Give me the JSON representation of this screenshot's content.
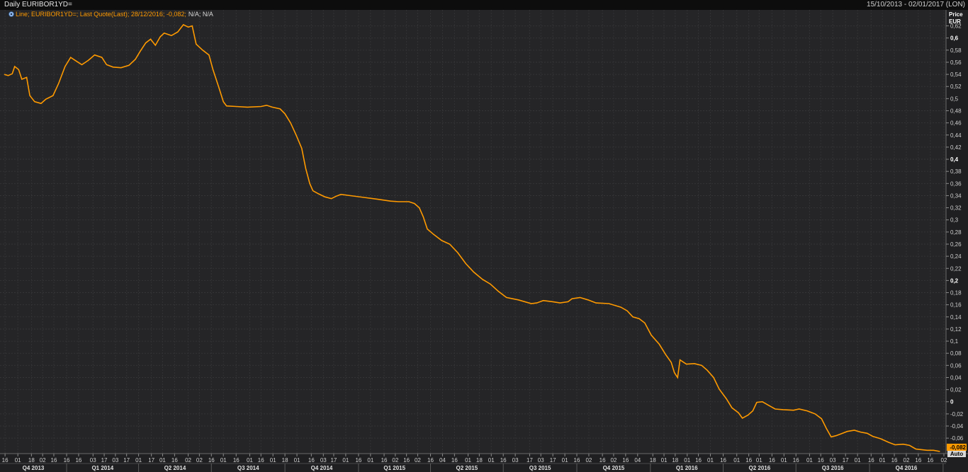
{
  "window": {
    "title": "Daily EURIBOR1YD=",
    "date_range": "15/10/2013 - 02/01/2017 (LON)"
  },
  "legend": {
    "text": "Line; EURIBOR1YD=; Last Quote(Last); 28/12/2016; -0,082;",
    "na_text": "N/A; N/A",
    "icon": "gear-icon"
  },
  "axis": {
    "unit_label_1": "Price",
    "unit_label_2": "EUR",
    "auto_label": "Auto",
    "last_value_label": "-0,082"
  },
  "colors": {
    "series": "#ff9a00",
    "background": "#252527",
    "grid": "#3a3a3c",
    "last_value_bg": "#ff9a00"
  },
  "chart_data": {
    "type": "line",
    "series": [
      {
        "name": "EURIBOR1YD=",
        "points": [
          [
            "2013-10-15",
            0.54
          ],
          [
            "2013-10-20",
            0.538
          ],
          [
            "2013-10-25",
            0.541
          ],
          [
            "2013-10-28",
            0.553
          ],
          [
            "2013-11-02",
            0.548
          ],
          [
            "2013-11-06",
            0.532
          ],
          [
            "2013-11-12",
            0.535
          ],
          [
            "2013-11-16",
            0.505
          ],
          [
            "2013-11-22",
            0.495
          ],
          [
            "2013-11-30",
            0.492
          ],
          [
            "2013-12-06",
            0.499
          ],
          [
            "2013-12-15",
            0.505
          ],
          [
            "2013-12-22",
            0.525
          ],
          [
            "2013-12-30",
            0.553
          ],
          [
            "2014-01-06",
            0.568
          ],
          [
            "2014-01-14",
            0.561
          ],
          [
            "2014-01-20",
            0.556
          ],
          [
            "2014-01-28",
            0.563
          ],
          [
            "2014-02-05",
            0.572
          ],
          [
            "2014-02-14",
            0.568
          ],
          [
            "2014-02-20",
            0.556
          ],
          [
            "2014-02-28",
            0.552
          ],
          [
            "2014-03-10",
            0.551
          ],
          [
            "2014-03-20",
            0.555
          ],
          [
            "2014-03-28",
            0.565
          ],
          [
            "2014-04-03",
            0.578
          ],
          [
            "2014-04-10",
            0.592
          ],
          [
            "2014-04-16",
            0.598
          ],
          [
            "2014-04-22",
            0.588
          ],
          [
            "2014-04-28",
            0.602
          ],
          [
            "2014-05-03",
            0.608
          ],
          [
            "2014-05-12",
            0.604
          ],
          [
            "2014-05-20",
            0.61
          ],
          [
            "2014-05-27",
            0.622
          ],
          [
            "2014-06-02",
            0.618
          ],
          [
            "2014-06-07",
            0.62
          ],
          [
            "2014-06-12",
            0.59
          ],
          [
            "2014-06-20",
            0.58
          ],
          [
            "2014-06-28",
            0.572
          ],
          [
            "2014-07-03",
            0.548
          ],
          [
            "2014-07-10",
            0.52
          ],
          [
            "2014-07-16",
            0.495
          ],
          [
            "2014-07-20",
            0.488
          ],
          [
            "2014-08-01",
            0.487
          ],
          [
            "2014-08-15",
            0.486
          ],
          [
            "2014-09-01",
            0.487
          ],
          [
            "2014-09-08",
            0.489
          ],
          [
            "2014-09-15",
            0.486
          ],
          [
            "2014-09-25",
            0.483
          ],
          [
            "2014-10-01",
            0.475
          ],
          [
            "2014-10-08",
            0.46
          ],
          [
            "2014-10-15",
            0.44
          ],
          [
            "2014-10-22",
            0.418
          ],
          [
            "2014-10-27",
            0.385
          ],
          [
            "2014-11-01",
            0.36
          ],
          [
            "2014-11-05",
            0.348
          ],
          [
            "2014-11-12",
            0.343
          ],
          [
            "2014-11-20",
            0.338
          ],
          [
            "2014-11-28",
            0.335
          ],
          [
            "2014-12-04",
            0.339
          ],
          [
            "2014-12-10",
            0.342
          ],
          [
            "2014-12-22",
            0.34
          ],
          [
            "2015-01-08",
            0.337
          ],
          [
            "2015-01-25",
            0.334
          ],
          [
            "2015-02-10",
            0.331
          ],
          [
            "2015-02-20",
            0.33
          ],
          [
            "2015-03-05",
            0.33
          ],
          [
            "2015-03-12",
            0.327
          ],
          [
            "2015-03-18",
            0.32
          ],
          [
            "2015-03-23",
            0.305
          ],
          [
            "2015-03-28",
            0.285
          ],
          [
            "2015-04-05",
            0.276
          ],
          [
            "2015-04-15",
            0.266
          ],
          [
            "2015-04-25",
            0.26
          ],
          [
            "2015-05-05",
            0.246
          ],
          [
            "2015-05-15",
            0.228
          ],
          [
            "2015-05-25",
            0.214
          ],
          [
            "2015-06-05",
            0.202
          ],
          [
            "2015-06-15",
            0.194
          ],
          [
            "2015-06-25",
            0.182
          ],
          [
            "2015-07-05",
            0.172
          ],
          [
            "2015-07-20",
            0.168
          ],
          [
            "2015-08-05",
            0.162
          ],
          [
            "2015-08-12",
            0.163
          ],
          [
            "2015-08-20",
            0.167
          ],
          [
            "2015-09-01",
            0.165
          ],
          [
            "2015-09-10",
            0.163
          ],
          [
            "2015-09-20",
            0.165
          ],
          [
            "2015-09-25",
            0.17
          ],
          [
            "2015-10-05",
            0.172
          ],
          [
            "2015-10-15",
            0.168
          ],
          [
            "2015-10-25",
            0.163
          ],
          [
            "2015-11-10",
            0.162
          ],
          [
            "2015-11-25",
            0.156
          ],
          [
            "2015-12-03",
            0.15
          ],
          [
            "2015-12-10",
            0.14
          ],
          [
            "2015-12-18",
            0.137
          ],
          [
            "2015-12-25",
            0.13
          ],
          [
            "2016-01-02",
            0.11
          ],
          [
            "2016-01-12",
            0.095
          ],
          [
            "2016-01-20",
            0.078
          ],
          [
            "2016-01-27",
            0.065
          ],
          [
            "2016-01-31",
            0.048
          ],
          [
            "2016-02-04",
            0.04
          ],
          [
            "2016-02-07",
            0.069
          ],
          [
            "2016-02-15",
            0.062
          ],
          [
            "2016-02-25",
            0.063
          ],
          [
            "2016-03-05",
            0.06
          ],
          [
            "2016-03-12",
            0.052
          ],
          [
            "2016-03-20",
            0.04
          ],
          [
            "2016-03-27",
            0.021
          ],
          [
            "2016-04-05",
            0.005
          ],
          [
            "2016-04-12",
            -0.01
          ],
          [
            "2016-04-20",
            -0.018
          ],
          [
            "2016-04-25",
            -0.027
          ],
          [
            "2016-05-02",
            -0.022
          ],
          [
            "2016-05-08",
            -0.015
          ],
          [
            "2016-05-13",
            -0.001
          ],
          [
            "2016-05-20",
            0.0
          ],
          [
            "2016-05-28",
            -0.006
          ],
          [
            "2016-06-05",
            -0.012
          ],
          [
            "2016-06-15",
            -0.013
          ],
          [
            "2016-06-28",
            -0.014
          ],
          [
            "2016-07-05",
            -0.012
          ],
          [
            "2016-07-15",
            -0.015
          ],
          [
            "2016-07-25",
            -0.02
          ],
          [
            "2016-08-02",
            -0.028
          ],
          [
            "2016-08-08",
            -0.044
          ],
          [
            "2016-08-14",
            -0.058
          ],
          [
            "2016-08-20",
            -0.056
          ],
          [
            "2016-08-26",
            -0.053
          ],
          [
            "2016-09-03",
            -0.049
          ],
          [
            "2016-09-12",
            -0.047
          ],
          [
            "2016-09-20",
            -0.05
          ],
          [
            "2016-09-28",
            -0.052
          ],
          [
            "2016-10-05",
            -0.057
          ],
          [
            "2016-10-15",
            -0.061
          ],
          [
            "2016-10-25",
            -0.067
          ],
          [
            "2016-11-02",
            -0.071
          ],
          [
            "2016-11-12",
            -0.07
          ],
          [
            "2016-11-20",
            -0.072
          ],
          [
            "2016-11-28",
            -0.078
          ],
          [
            "2016-12-05",
            -0.079
          ],
          [
            "2016-12-12",
            -0.08
          ],
          [
            "2016-12-20",
            -0.08
          ],
          [
            "2016-12-28",
            -0.082
          ]
        ]
      }
    ],
    "x_range": [
      "2013-10-15",
      "2017-01-02"
    ],
    "ylim": [
      -0.082,
      0.63
    ],
    "y_ticks": [
      "0,62",
      "0,6",
      "0,58",
      "0,56",
      "0,54",
      "0,52",
      "0,5",
      "0,48",
      "0,46",
      "0,44",
      "0,42",
      "0,4",
      "0,38",
      "0,36",
      "0,34",
      "0,32",
      "0,3",
      "0,28",
      "0,26",
      "0,24",
      "0,22",
      "0,2",
      "0,18",
      "0,16",
      "0,14",
      "0,12",
      "0,1",
      "0,08",
      "0,06",
      "0,04",
      "0,02",
      "0",
      "-0,02",
      "-0,04",
      "-0,06"
    ],
    "y_tick_values": [
      0.62,
      0.6,
      0.58,
      0.56,
      0.54,
      0.52,
      0.5,
      0.48,
      0.46,
      0.44,
      0.42,
      0.4,
      0.38,
      0.36,
      0.34,
      0.32,
      0.3,
      0.28,
      0.26,
      0.24,
      0.22,
      0.2,
      0.18,
      0.16,
      0.14,
      0.12,
      0.1,
      0.08,
      0.06,
      0.04,
      0.02,
      0,
      -0.02,
      -0.04,
      -0.06
    ],
    "y_bold_ticks": [
      "0,6",
      "0,4",
      "0,2",
      "0"
    ],
    "x_day_ticks": [
      [
        "2013-10-16",
        "16"
      ],
      [
        "2013-11-01",
        "01"
      ],
      [
        "2013-11-18",
        "18"
      ],
      [
        "2013-12-02",
        "02"
      ],
      [
        "2013-12-16",
        "16"
      ],
      [
        "2014-01-01",
        "16"
      ],
      [
        "2014-01-16",
        "16"
      ],
      [
        "2014-02-03",
        "03"
      ],
      [
        "2014-02-17",
        "17"
      ],
      [
        "2014-03-03",
        "03"
      ],
      [
        "2014-03-17",
        "17"
      ],
      [
        "2014-04-01",
        "01"
      ],
      [
        "2014-04-17",
        "17"
      ],
      [
        "2014-05-01",
        "01"
      ],
      [
        "2014-05-16",
        "16"
      ],
      [
        "2014-06-02",
        "02"
      ],
      [
        "2014-06-16",
        "02"
      ],
      [
        "2014-07-01",
        "16"
      ],
      [
        "2014-07-16",
        "01"
      ],
      [
        "2014-08-01",
        "16"
      ],
      [
        "2014-08-18",
        "01"
      ],
      [
        "2014-09-01",
        "16"
      ],
      [
        "2014-09-16",
        "01"
      ],
      [
        "2014-10-01",
        "18"
      ],
      [
        "2014-10-16",
        "01"
      ],
      [
        "2014-11-03",
        "16"
      ],
      [
        "2014-11-18",
        "03"
      ],
      [
        "2014-12-01",
        "17"
      ],
      [
        "2014-12-16",
        "01"
      ],
      [
        "2015-01-01",
        "16"
      ],
      [
        "2015-01-16",
        "01"
      ],
      [
        "2015-02-02",
        "16"
      ],
      [
        "2015-02-16",
        "02"
      ],
      [
        "2015-03-02",
        "16"
      ],
      [
        "2015-03-16",
        "02"
      ],
      [
        "2015-04-01",
        "16"
      ],
      [
        "2015-04-16",
        "04"
      ],
      [
        "2015-05-01",
        "16"
      ],
      [
        "2015-05-18",
        "01"
      ],
      [
        "2015-06-01",
        "18"
      ],
      [
        "2015-06-16",
        "01"
      ],
      [
        "2015-07-01",
        "16"
      ],
      [
        "2015-07-16",
        "03"
      ],
      [
        "2015-08-03",
        "17"
      ],
      [
        "2015-08-17",
        "03"
      ],
      [
        "2015-09-01",
        "17"
      ],
      [
        "2015-09-16",
        "01"
      ],
      [
        "2015-10-01",
        "16"
      ],
      [
        "2015-10-16",
        "02"
      ],
      [
        "2015-11-02",
        "16"
      ],
      [
        "2015-11-16",
        "02"
      ],
      [
        "2015-12-01",
        "16"
      ],
      [
        "2015-12-16",
        "04"
      ],
      [
        "2016-01-04",
        "18"
      ],
      [
        "2016-01-18",
        "01"
      ],
      [
        "2016-02-01",
        "18"
      ],
      [
        "2016-02-16",
        "01"
      ],
      [
        "2016-03-01",
        "16"
      ],
      [
        "2016-03-16",
        "01"
      ],
      [
        "2016-04-01",
        "16"
      ],
      [
        "2016-04-18",
        "01"
      ],
      [
        "2016-05-03",
        "16"
      ],
      [
        "2016-05-16",
        "01"
      ],
      [
        "2016-06-01",
        "16"
      ],
      [
        "2016-06-16",
        "01"
      ],
      [
        "2016-07-01",
        "16"
      ],
      [
        "2016-07-18",
        "01"
      ],
      [
        "2016-08-01",
        "16"
      ],
      [
        "2016-08-16",
        "03"
      ],
      [
        "2016-09-01",
        "17"
      ],
      [
        "2016-09-16",
        "01"
      ],
      [
        "2016-10-03",
        "16"
      ],
      [
        "2016-10-17",
        "01"
      ],
      [
        "2016-11-01",
        "16"
      ],
      [
        "2016-11-16",
        "02"
      ],
      [
        "2016-12-01",
        "16"
      ],
      [
        "2016-12-16",
        "16"
      ],
      [
        "2017-01-02",
        "02"
      ]
    ],
    "x_quarters": [
      [
        "2013-10-01",
        "2014-01-01",
        "Q4 2013"
      ],
      [
        "2014-01-01",
        "2014-04-01",
        "Q1 2014"
      ],
      [
        "2014-04-01",
        "2014-07-01",
        "Q2 2014"
      ],
      [
        "2014-07-01",
        "2014-10-01",
        "Q3 2014"
      ],
      [
        "2014-10-01",
        "2015-01-01",
        "Q4 2014"
      ],
      [
        "2015-01-01",
        "2015-04-01",
        "Q1 2015"
      ],
      [
        "2015-04-01",
        "2015-07-01",
        "Q2 2015"
      ],
      [
        "2015-07-01",
        "2015-10-01",
        "Q3 2015"
      ],
      [
        "2015-10-01",
        "2016-01-01",
        "Q4 2015"
      ],
      [
        "2016-01-01",
        "2016-04-01",
        "Q1 2016"
      ],
      [
        "2016-04-01",
        "2016-07-01",
        "Q2 2016"
      ],
      [
        "2016-07-01",
        "2016-10-01",
        "Q3 2016"
      ],
      [
        "2016-10-01",
        "2017-01-01",
        "Q4 2016"
      ]
    ],
    "grid": true,
    "legend_position": "top-left"
  }
}
